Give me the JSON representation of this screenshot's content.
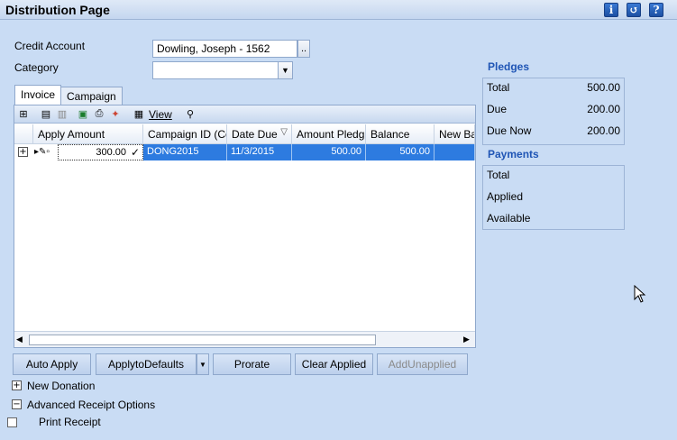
{
  "window": {
    "title": "Distribution Page",
    "buttons": [
      "i",
      "↺",
      "?"
    ]
  },
  "form": {
    "credit_account_label": "Credit Account",
    "credit_account_value": "Dowling, Joseph - 1562",
    "lookup_button": "..",
    "category_label": "Category",
    "category_value": ""
  },
  "tabs": [
    "Invoice",
    "Campaign"
  ],
  "grid": {
    "toolbar": {
      "view_label": "View"
    },
    "columns": [
      "Apply Amount",
      "Campaign ID (Co",
      "Date Due",
      "Amount Pledg",
      "Balance",
      "New Ba"
    ],
    "rows": [
      {
        "expand": "+",
        "apply_amount": "300.00",
        "campaign_id": "DONG2015",
        "date_due": "11/3/2015",
        "amount_pledged": "500.00",
        "balance": "500.00",
        "new_balance": ""
      }
    ]
  },
  "buttons": {
    "auto_apply": "Auto Apply",
    "apply_to_defaults": "ApplytoDefaults",
    "prorate": "Prorate",
    "clear_applied": "Clear Applied",
    "add_unapplied": "AddUnapplied"
  },
  "options": {
    "new_donation": "New Donation",
    "advanced_receipt": "Advanced Receipt Options",
    "print_receipt": "Print Receipt"
  },
  "pledges": {
    "title": "Pledges",
    "rows": [
      {
        "label": "Total",
        "value": "500.00"
      },
      {
        "label": "Due",
        "value": "200.00"
      },
      {
        "label": "Due Now",
        "value": "200.00"
      }
    ]
  },
  "payments": {
    "title": "Payments",
    "rows": [
      {
        "label": "Total",
        "value": ""
      },
      {
        "label": "Applied",
        "value": ""
      },
      {
        "label": "Available",
        "value": ""
      }
    ]
  }
}
